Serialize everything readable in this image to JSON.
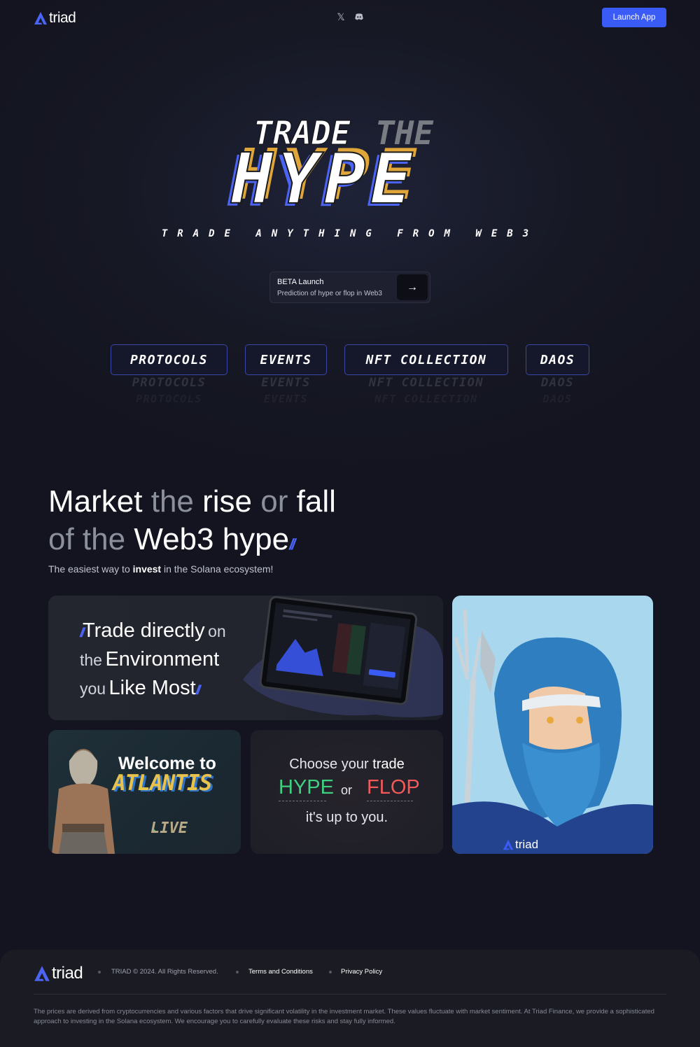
{
  "header": {
    "logo_text": "triad",
    "social_icons": [
      "x-icon",
      "discord-icon"
    ],
    "launch_label": "Launch App"
  },
  "hero": {
    "headline_top_1": "TRADE",
    "headline_top_2": "THE",
    "headline_main": "HYPE",
    "tagline": "TRADE ANYTHING FROM WEB3",
    "beta_title": "BETA Launch",
    "beta_subtitle": "Prediction of hype or flop in Web3",
    "categories": [
      "PROTOCOLS",
      "EVENTS",
      "NFT COLLECTION",
      "DAOS"
    ]
  },
  "market": {
    "title_w1": "Market",
    "title_w2": "the",
    "title_w3": "rise",
    "title_w4": "or",
    "title_w5": "fall",
    "title_w6": "of the",
    "title_w7": "Web3 hype",
    "sub_pre": "The easiest way to",
    "sub_bold": "invest",
    "sub_post": "in the Solana ecosystem!"
  },
  "cards": {
    "trade": {
      "w1": "Trade directly",
      "w2": "on",
      "w3": "the",
      "w4": "Environment",
      "w5": "you",
      "w6": "Like Most"
    },
    "atlantis": {
      "welcome": "Welcome to",
      "name": "ATLANTIS",
      "live": "LIVE"
    },
    "choose": {
      "pre": "Choose your",
      "bold": "trade",
      "hype": "HYPE",
      "or": "or",
      "flop": "FLOP",
      "post": "it's up to you."
    },
    "poseidon": {
      "brand": "triad"
    }
  },
  "footer": {
    "logo_text": "triad",
    "copyright": "TRIAD © 2024. All Rights Reserved.",
    "terms": "Terms and Conditions",
    "privacy": "Privacy Policy",
    "disclaimer": "The prices are derived from cryptocurrencies and various factors that drive significant volatility in the investment market. These values fluctuate with market sentiment. At Triad Finance, we provide a sophisticated approach to investing in the Solana ecosystem. We encourage you to carefully evaluate these risks and stay fully informed."
  },
  "colors": {
    "accent": "#3b5bf6",
    "hype_green": "#3ecf7f",
    "flop_red": "#f25a5a",
    "gold": "#e0a63a"
  }
}
